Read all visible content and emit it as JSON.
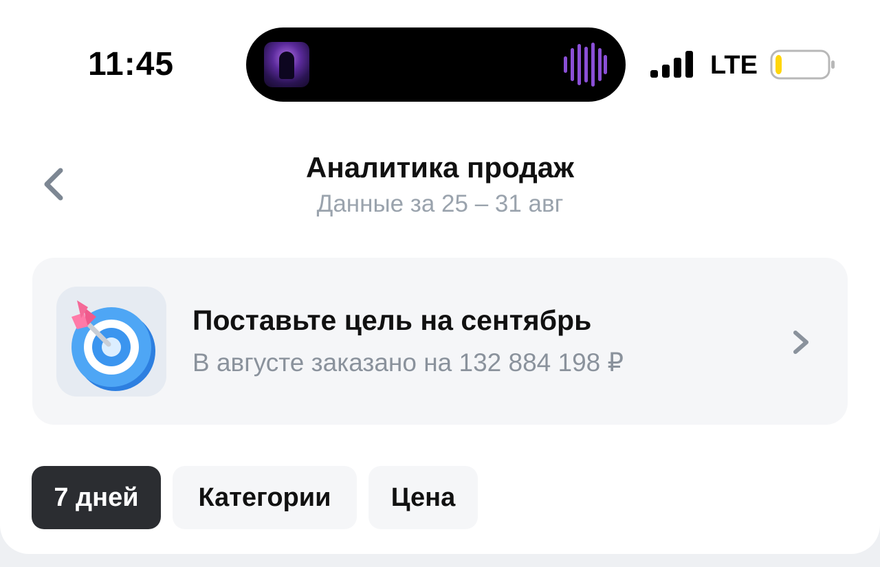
{
  "status_bar": {
    "time": "11:45",
    "network": "LTE",
    "battery_level": 0.12,
    "battery_color": "#ffd60a"
  },
  "header": {
    "title": "Аналитика продаж",
    "subtitle": "Данные за 25 – 31 авг",
    "back_icon": "chevron-left-icon"
  },
  "goal_card": {
    "title": "Поставьте цель на сентябрь",
    "subtitle": "В августе заказано на 132 884 198 ₽",
    "icon": "target-icon",
    "chevron_icon": "chevron-right-icon"
  },
  "filters": {
    "chips": [
      {
        "label": "7 дней",
        "active": true
      },
      {
        "label": "Категории",
        "active": false
      },
      {
        "label": "Цена",
        "active": false
      }
    ]
  },
  "colors": {
    "text_primary": "#111111",
    "text_secondary": "#9aa3ad",
    "card_bg": "#f5f6f8",
    "chip_active_bg": "#2b2d31",
    "accent_purple": "#8a4fd6"
  }
}
